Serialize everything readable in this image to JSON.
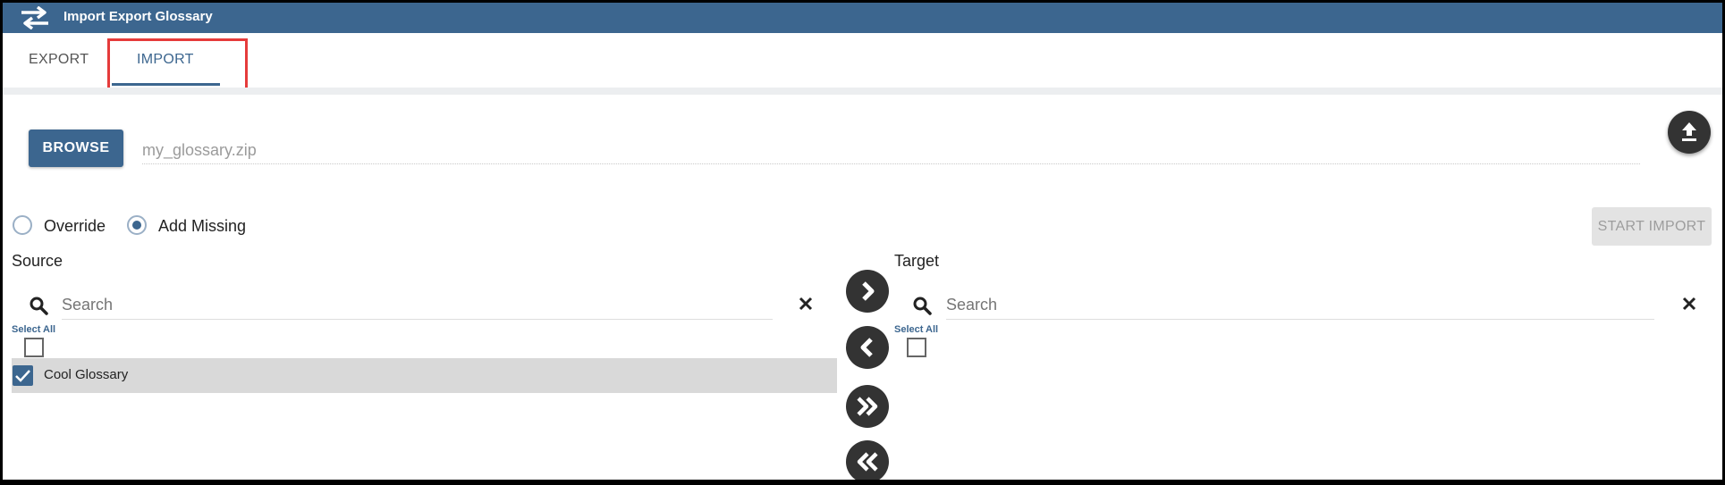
{
  "window": {
    "title": "Import Export Glossary",
    "icon": "swap-arrows-icon"
  },
  "tabs": [
    {
      "label": "EXPORT",
      "active": false
    },
    {
      "label": "IMPORT",
      "active": true
    }
  ],
  "import": {
    "browse_label": "BROWSE",
    "file_value": "my_glossary.zip",
    "upload_icon": "upload-icon",
    "options": [
      {
        "label": "Override",
        "checked": false
      },
      {
        "label": "Add Missing",
        "checked": true
      }
    ],
    "start_label": "START IMPORT"
  },
  "source": {
    "title": "Source",
    "search_placeholder": "Search",
    "select_all_label": "Select All",
    "items": [
      {
        "label": "Cool Glossary",
        "checked": true
      }
    ]
  },
  "target": {
    "title": "Target",
    "search_placeholder": "Search",
    "select_all_label": "Select All",
    "items": []
  },
  "move_buttons": [
    "move-right-icon",
    "move-left-icon",
    "move-all-right-icon",
    "move-all-left-icon"
  ],
  "colors": {
    "accent": "#3c668f",
    "highlight": "#e53b3b",
    "dark_button": "#333333",
    "row_selected": "#d9d9d9"
  }
}
